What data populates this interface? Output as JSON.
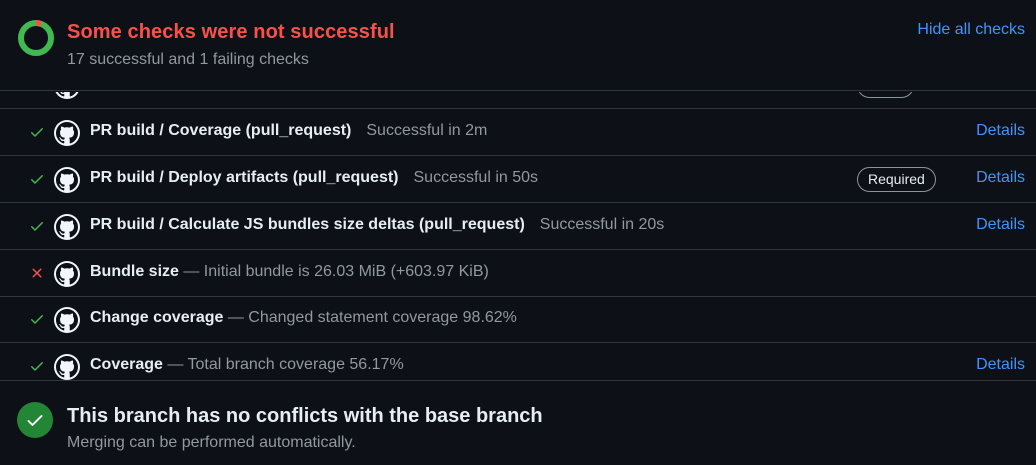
{
  "header": {
    "title": "Some checks were not successful",
    "subtitle": "17 successful and 1 failing checks",
    "hide_link": "Hide all checks",
    "status_icon": "progress-ring-icon",
    "successful_count": 17,
    "failing_count": 1
  },
  "checks": [
    {
      "status": "success",
      "name": "PR build / Coverage (pull_request)",
      "desc": "Successful in 2m",
      "separator": "",
      "required": false,
      "details": "Details"
    },
    {
      "status": "success",
      "name": "PR build / Deploy artifacts (pull_request)",
      "desc": "Successful in 50s",
      "separator": "",
      "required": true,
      "required_label": "Required",
      "details": "Details"
    },
    {
      "status": "success",
      "name": "PR build / Calculate JS bundles size deltas (pull_request)",
      "desc": "Successful in 20s",
      "separator": "",
      "required": false,
      "details": "Details"
    },
    {
      "status": "failure",
      "name": "Bundle size",
      "desc": "Initial bundle is 26.03 MiB (+603.97 KiB)",
      "separator": " — ",
      "required": false,
      "details": ""
    },
    {
      "status": "success",
      "name": "Change coverage",
      "desc": "Changed statement coverage 98.62%",
      "separator": " — ",
      "required": false,
      "details": ""
    },
    {
      "status": "success",
      "name": "Coverage",
      "desc": "Total branch coverage 56.17%",
      "separator": " — ",
      "required": false,
      "details": "Details"
    }
  ],
  "merge": {
    "title": "This branch has no conflicts with the base branch",
    "subtitle": "Merging can be performed automatically.",
    "icon": "check-circle-icon"
  },
  "colors": {
    "success": "#3fb950",
    "failure": "#f85149",
    "link": "#4493f8",
    "merge_green": "#238636"
  }
}
